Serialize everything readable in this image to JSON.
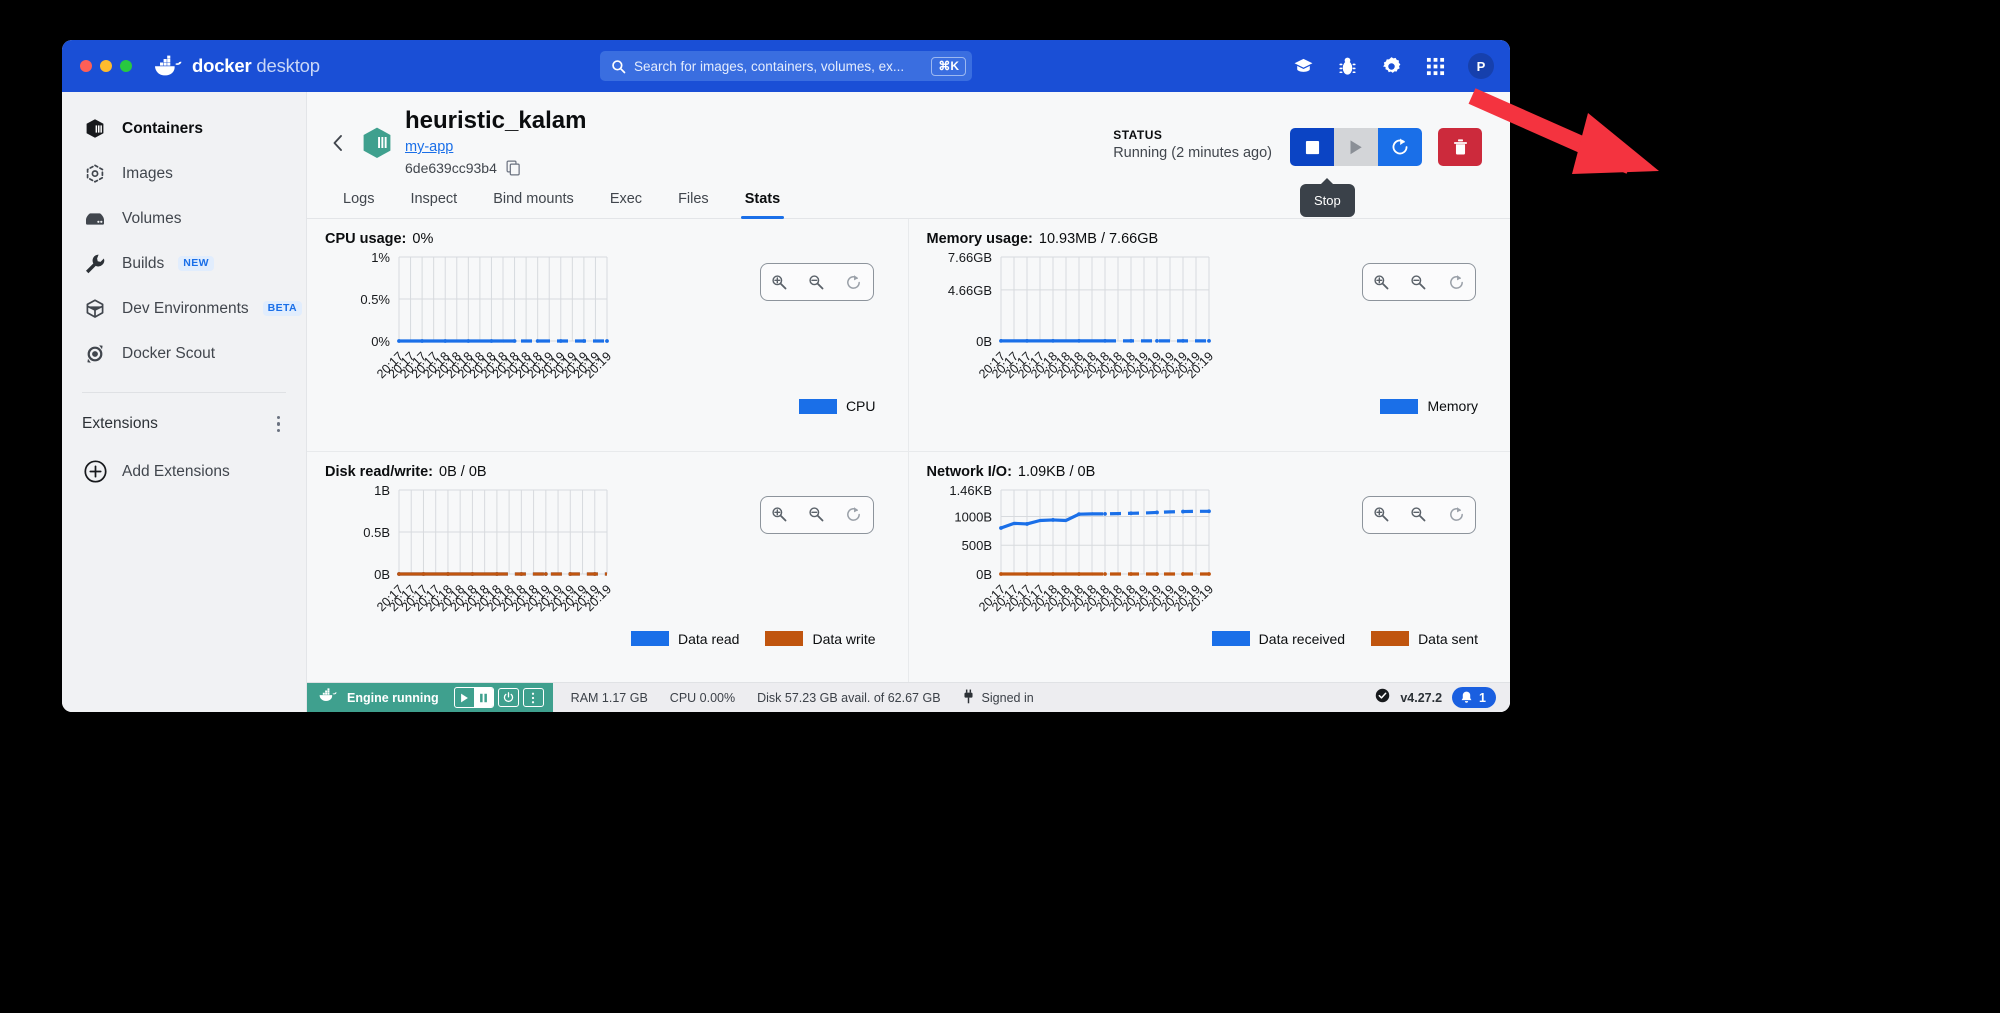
{
  "window": {
    "traffic_lights": [
      "close",
      "minimize",
      "maximize"
    ],
    "brand_bold": "docker",
    "brand_light": "desktop"
  },
  "search": {
    "placeholder": "Search for images, containers, volumes, ex...",
    "value": "",
    "shortcut": "⌘K"
  },
  "titlebar_icons": [
    {
      "name": "learning-center-icon",
      "glyph": "learning"
    },
    {
      "name": "bug-report-icon",
      "glyph": "bug"
    },
    {
      "name": "settings-gear-icon",
      "glyph": "gear"
    },
    {
      "name": "apps-grid-icon",
      "glyph": "grid"
    }
  ],
  "avatar": {
    "initial": "P"
  },
  "sidebar": {
    "items": [
      {
        "label": "Containers",
        "icon": "container-icon",
        "active": true,
        "tag": ""
      },
      {
        "label": "Images",
        "icon": "images-icon",
        "active": false,
        "tag": ""
      },
      {
        "label": "Volumes",
        "icon": "volumes-icon",
        "active": false,
        "tag": ""
      },
      {
        "label": "Builds",
        "icon": "wrench-icon",
        "active": false,
        "tag": "NEW"
      },
      {
        "label": "Dev Environments",
        "icon": "dev-env-icon",
        "active": false,
        "tag": "BETA"
      },
      {
        "label": "Docker Scout",
        "icon": "scout-icon",
        "active": false,
        "tag": ""
      }
    ],
    "extensions_label": "Extensions",
    "add_extensions_label": "Add Extensions"
  },
  "container": {
    "name": "heuristic_kalam",
    "app_link": "my-app",
    "id": "6de639cc93b4",
    "status_label": "STATUS",
    "status_value": "Running (2 minutes ago)"
  },
  "actions": {
    "stop": "Stop",
    "start": "Start",
    "restart": "Restart",
    "delete": "Delete",
    "tooltip": "Stop"
  },
  "tabs": [
    {
      "label": "Logs",
      "active": false
    },
    {
      "label": "Inspect",
      "active": false
    },
    {
      "label": "Bind mounts",
      "active": false
    },
    {
      "label": "Exec",
      "active": false
    },
    {
      "label": "Files",
      "active": false
    },
    {
      "label": "Stats",
      "active": true
    }
  ],
  "zoom_controls": {
    "zoom_in": "zoom-in",
    "zoom_out": "zoom-out",
    "reset": "reset"
  },
  "colors": {
    "brand_blue": "#1a4fd6",
    "accent_blue": "#1a6fe8",
    "series_blue": "#1a6fe8",
    "series_orange": "#c0550f",
    "danger_red": "#cc2a3c",
    "engine_teal": "#3fa08e",
    "arrow_red": "#f4333f"
  },
  "chart_data": [
    {
      "type": "line",
      "id": "cpu-usage-chart",
      "title": "CPU usage:",
      "title_value": "0%",
      "ylabel": "",
      "xlabel": "",
      "ytick_labels": [
        "0%",
        "0.5%",
        "1%"
      ],
      "ytick_values": [
        0,
        0.5,
        1
      ],
      "ylim": [
        0,
        1
      ],
      "x": [
        "20:17",
        "20:17",
        "20:17",
        "20:17",
        "20:18",
        "20:18",
        "20:18",
        "20:18",
        "20:18",
        "20:18",
        "20:18",
        "20:18",
        "20:18",
        "20:19",
        "20:19",
        "20:19",
        "20:19",
        "20:19",
        "20:19"
      ],
      "grid": true,
      "legend_position": "bottom-right",
      "series": [
        {
          "name": "CPU",
          "color": "#1a6fe8",
          "dashed_from_index": 9,
          "values": [
            0,
            0,
            0,
            0,
            0,
            0,
            0,
            0,
            0,
            0,
            0,
            0,
            0,
            0,
            0,
            0,
            0,
            0,
            0
          ]
        }
      ]
    },
    {
      "type": "line",
      "id": "memory-usage-chart",
      "title": "Memory usage:",
      "title_value": "10.93MB / 7.66GB",
      "ylabel": "",
      "xlabel": "",
      "ytick_labels": [
        "0B",
        "4.66GB",
        "7.66GB"
      ],
      "ytick_values": [
        0,
        4.66,
        7.66
      ],
      "ylim": [
        0,
        7.66
      ],
      "x": [
        "20:17",
        "20:17",
        "20:17",
        "20:17",
        "20:18",
        "20:18",
        "20:18",
        "20:18",
        "20:18",
        "20:18",
        "20:18",
        "20:19",
        "20:19",
        "20:19",
        "20:19",
        "20:19",
        "20:19"
      ],
      "grid": true,
      "legend_position": "bottom-right",
      "series": [
        {
          "name": "Memory",
          "color": "#1a6fe8",
          "dashed_from_index": 8,
          "values": [
            0.011,
            0.011,
            0.011,
            0.011,
            0.011,
            0.011,
            0.011,
            0.011,
            0.011,
            0.011,
            0.011,
            0.011,
            0.011,
            0.011,
            0.011,
            0.011,
            0.011
          ]
        }
      ]
    },
    {
      "type": "line",
      "id": "disk-read-write-chart",
      "title": "Disk read/write:",
      "title_value": "0B / 0B",
      "ylabel": "",
      "xlabel": "",
      "ytick_labels": [
        "0B",
        "0.5B",
        "1B"
      ],
      "ytick_values": [
        0,
        0.5,
        1
      ],
      "ylim": [
        0,
        1
      ],
      "x": [
        "20:17",
        "20:17",
        "20:17",
        "20:17",
        "20:18",
        "20:18",
        "20:18",
        "20:18",
        "20:18",
        "20:18",
        "20:18",
        "20:18",
        "20:19",
        "20:19",
        "20:19",
        "20:19",
        "20:19",
        "20:19"
      ],
      "grid": true,
      "legend_position": "bottom-right",
      "series": [
        {
          "name": "Data read",
          "color": "#1a6fe8",
          "dashed_from_index": 8,
          "values": [
            0,
            0,
            0,
            0,
            0,
            0,
            0,
            0,
            0,
            0,
            0,
            0,
            0,
            0,
            0,
            0,
            0,
            0
          ]
        },
        {
          "name": "Data write",
          "color": "#c0550f",
          "dashed_from_index": 8,
          "values": [
            0,
            0,
            0,
            0,
            0,
            0,
            0,
            0,
            0,
            0,
            0,
            0,
            0,
            0,
            0,
            0,
            0,
            0
          ]
        }
      ]
    },
    {
      "type": "line",
      "id": "network-io-chart",
      "title": "Network I/O:",
      "title_value": "1.09KB / 0B",
      "ylabel": "",
      "xlabel": "",
      "ytick_labels": [
        "0B",
        "500B",
        "1000B",
        "1.46KB"
      ],
      "ytick_values": [
        0,
        500,
        1000,
        1460
      ],
      "ylim": [
        0,
        1460
      ],
      "x": [
        "20:17",
        "20:17",
        "20:17",
        "20:17",
        "20:18",
        "20:18",
        "20:18",
        "20:18",
        "20:18",
        "20:18",
        "20:18",
        "20:19",
        "20:19",
        "20:19",
        "20:19",
        "20:19",
        "20:19"
      ],
      "grid": true,
      "legend_position": "bottom-right",
      "series": [
        {
          "name": "Data received",
          "color": "#1a6fe8",
          "dashed_from_index": 7,
          "values": [
            800,
            880,
            870,
            930,
            940,
            930,
            1040,
            1045,
            1045,
            1050,
            1055,
            1060,
            1070,
            1080,
            1085,
            1090,
            1090
          ]
        },
        {
          "name": "Data sent",
          "color": "#c0550f",
          "dashed_from_index": 7,
          "values": [
            0,
            0,
            0,
            0,
            0,
            0,
            0,
            0,
            0,
            0,
            0,
            0,
            0,
            0,
            0,
            0,
            0
          ]
        }
      ]
    }
  ],
  "statusbar": {
    "engine_label": "Engine running",
    "ram": "RAM 1.17 GB",
    "cpu": "CPU 0.00%",
    "disk": "Disk 57.23 GB avail. of 62.67 GB",
    "signed_in": "Signed in",
    "version": "v4.27.2",
    "notification_count": "1"
  }
}
